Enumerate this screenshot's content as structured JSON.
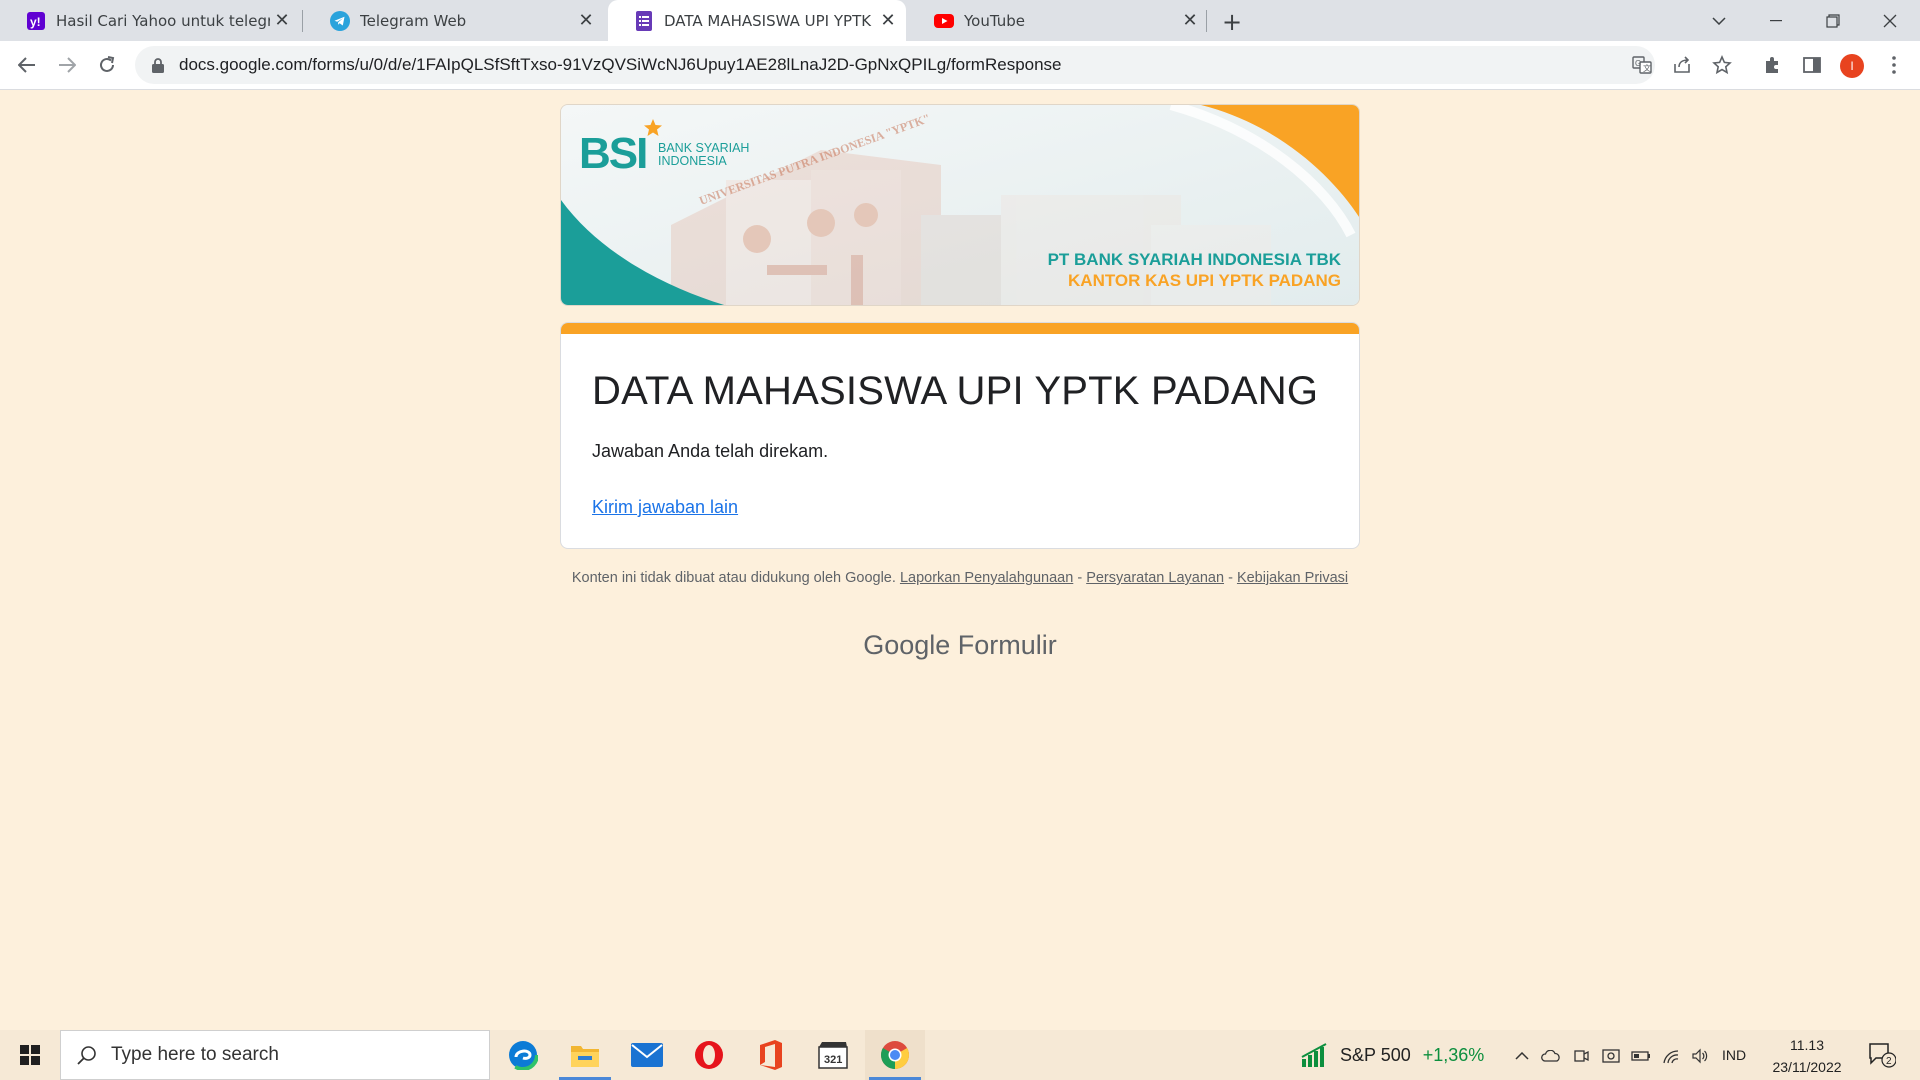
{
  "browser": {
    "tabs": [
      {
        "title": "Hasil Cari Yahoo untuk telegram w",
        "icon": "yahoo-icon",
        "active": false
      },
      {
        "title": "Telegram Web",
        "icon": "telegram-icon",
        "active": false
      },
      {
        "title": "DATA MAHASISWA UPI YPTK PAD",
        "icon": "google-forms-icon",
        "active": true
      },
      {
        "title": "YouTube",
        "icon": "youtube-icon",
        "active": false
      }
    ],
    "url": "docs.google.com/forms/u/0/d/e/1FAIpQLSfSftTxso-91VzQVSiWcNJ6Upuy1AE28lLnaJ2D-GpNxQPILg/formResponse",
    "profile_initial": "I",
    "colors": {
      "tabstrip": "#dee1e6",
      "profile": "#e8431f"
    }
  },
  "banner": {
    "logo_text": "BSI",
    "logo_sub_1": "BANK SYARIAH",
    "logo_sub_2": "INDONESIA",
    "building_text": "UNIVERSITAS PUTRA INDONESIA \"YPTK\"",
    "line1": "PT BANK SYARIAH INDONESIA TBK",
    "line2": "KANTOR KAS UPI YPTK PADANG",
    "colors": {
      "teal": "#1b9e99",
      "orange": "#f9a325"
    }
  },
  "form": {
    "title": "DATA MAHASISWA UPI YPTK PADANG",
    "message": "Jawaban Anda telah direkam.",
    "submit_another": "Kirim jawaban lain",
    "accent": "#f9a325"
  },
  "footer": {
    "disclaimer": "Konten ini tidak dibuat atau didukung oleh Google.",
    "report_abuse": "Laporkan Penyalahgunaan",
    "terms": "Persyaratan Layanan",
    "privacy": "Kebijakan Privasi",
    "sep": "-",
    "brand_google": "Google",
    "brand_product": "Formulir"
  },
  "taskbar": {
    "search_placeholder": "Type here to search",
    "apps": [
      "edge-icon",
      "file-explorer-icon",
      "mail-icon",
      "opera-icon",
      "office-icon",
      "clipchamp-icon",
      "chrome-icon"
    ],
    "stock_name": "S&P 500",
    "stock_change": "+1,36%",
    "language": "IND",
    "time": "11.13",
    "date": "23/11/2022",
    "notification_count": "2"
  }
}
